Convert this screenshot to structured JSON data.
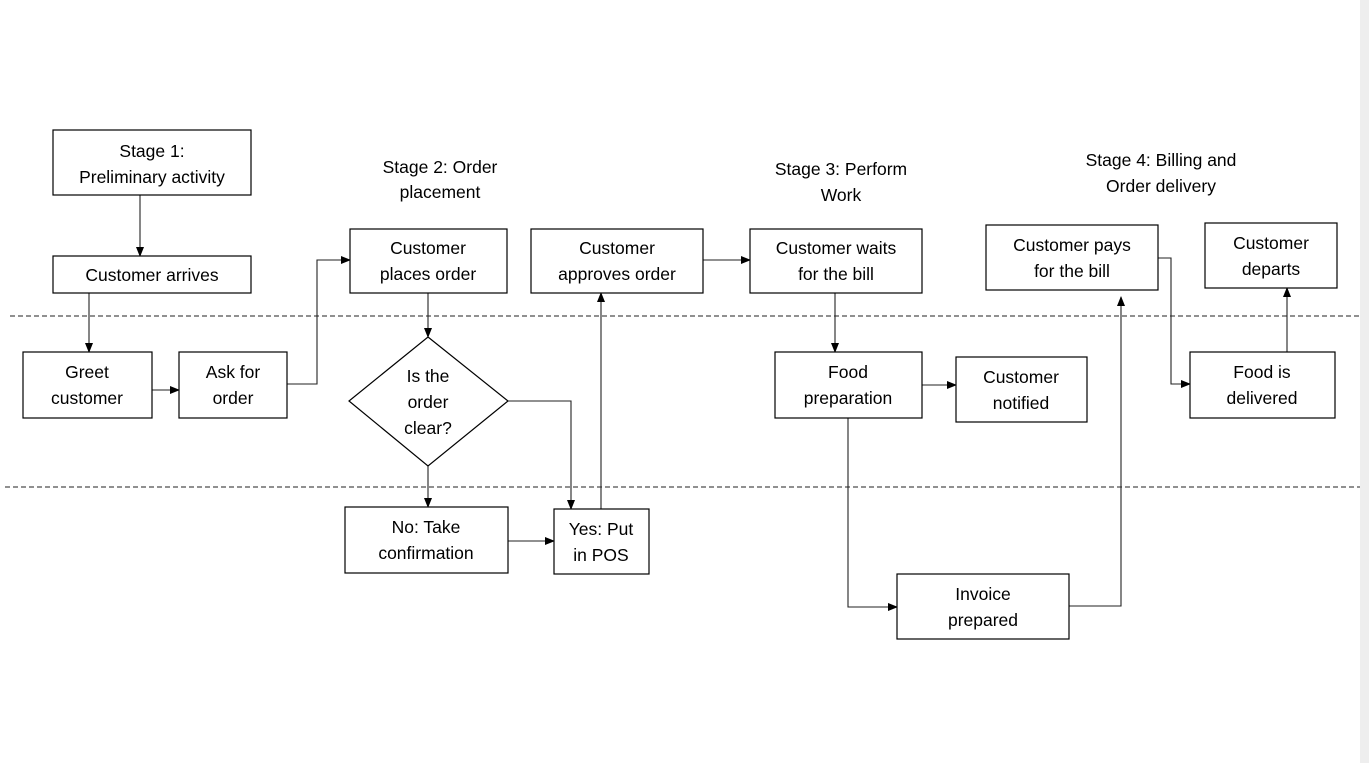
{
  "stages": {
    "stage1": [
      "Stage 1:",
      "Preliminary activity"
    ],
    "stage2": [
      "Stage 2: Order",
      "placement"
    ],
    "stage3": [
      "Stage 3: Perform",
      "Work"
    ],
    "stage4": [
      "Stage 4: Billing and",
      "Order delivery"
    ]
  },
  "nodes": {
    "arrives": [
      "Customer arrives"
    ],
    "greet": [
      "Greet",
      "customer"
    ],
    "ask": [
      "Ask for",
      "order"
    ],
    "places": [
      "Customer",
      "places order"
    ],
    "decision": [
      "Is the",
      "order",
      "clear?"
    ],
    "no": [
      "No: Take",
      "confirmation"
    ],
    "yes": [
      "Yes: Put",
      "in POS"
    ],
    "approves": [
      "Customer",
      "approves order"
    ],
    "waits": [
      "Customer waits",
      "for the bill"
    ],
    "food": [
      "Food",
      "preparation"
    ],
    "notified": [
      "Customer",
      "notified"
    ],
    "invoice": [
      "Invoice",
      "prepared"
    ],
    "pays": [
      "Customer pays",
      "for the bill"
    ],
    "delivered": [
      "Food is",
      "delivered"
    ],
    "departs": [
      "Customer",
      "departs"
    ]
  }
}
